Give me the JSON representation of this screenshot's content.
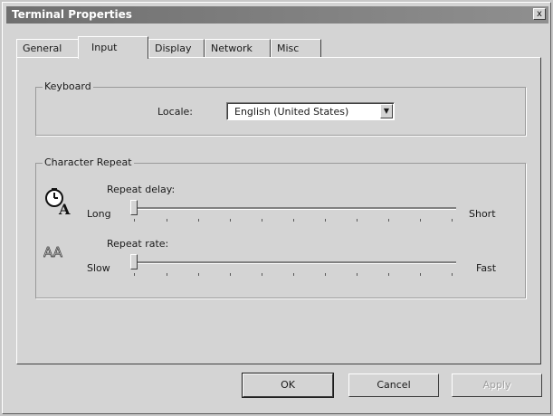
{
  "window": {
    "title": "Terminal Properties",
    "close_glyph": "x"
  },
  "tabs": [
    {
      "label": "General",
      "active": false
    },
    {
      "label": "Input",
      "active": true
    },
    {
      "label": "Display",
      "active": false
    },
    {
      "label": "Network",
      "active": false
    },
    {
      "label": "Misc",
      "active": false
    }
  ],
  "keyboard": {
    "legend": "Keyboard",
    "locale_label": "Locale:",
    "locale_value": "English (United States)"
  },
  "character_repeat": {
    "legend": "Character Repeat",
    "repeat_delay": {
      "label": "Repeat delay:",
      "min_label": "Long",
      "max_label": "Short",
      "value": 0,
      "icon": "clock-letter-icon"
    },
    "repeat_rate": {
      "label": "Repeat rate:",
      "min_label": "Slow",
      "max_label": "Fast",
      "value": 0,
      "icon": "double-letter-icon"
    }
  },
  "buttons": {
    "ok": "OK",
    "cancel": "Cancel",
    "apply": "Apply"
  }
}
